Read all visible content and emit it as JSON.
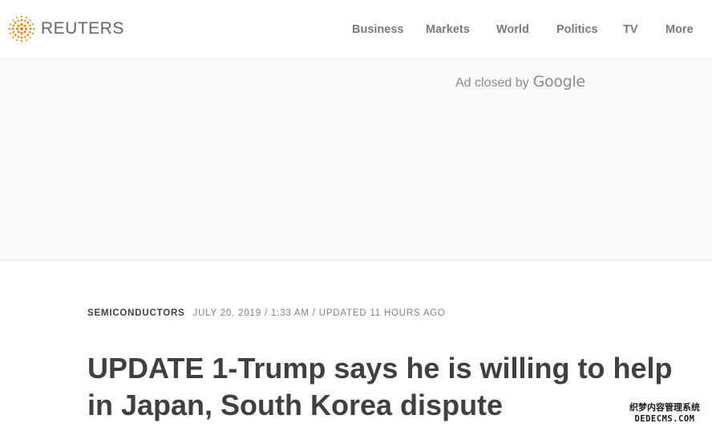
{
  "header": {
    "brand": "REUTERS",
    "nav": [
      {
        "label": "Business"
      },
      {
        "label": "Markets"
      },
      {
        "label": "World"
      },
      {
        "label": "Politics"
      },
      {
        "label": "TV"
      },
      {
        "label": "More"
      }
    ]
  },
  "ad": {
    "closed_text": "Ad closed by",
    "provider": "Google"
  },
  "article": {
    "section": "SEMICONDUCTORS",
    "dateline": "JULY 20, 2019 / 1:33 AM / UPDATED 11 HOURS AGO",
    "headline": "UPDATE 1-Trump says he is willing to help in Japan, South Korea dispute"
  },
  "watermark": {
    "text_line_1": "织梦内容管理系统",
    "text_line_2": "DEDECMS.COM"
  },
  "colors": {
    "brand_orange": "#f28a22",
    "nav_text": "#7a7a7a",
    "headline_text": "#404040",
    "ad_background": "#f9f8fa"
  }
}
